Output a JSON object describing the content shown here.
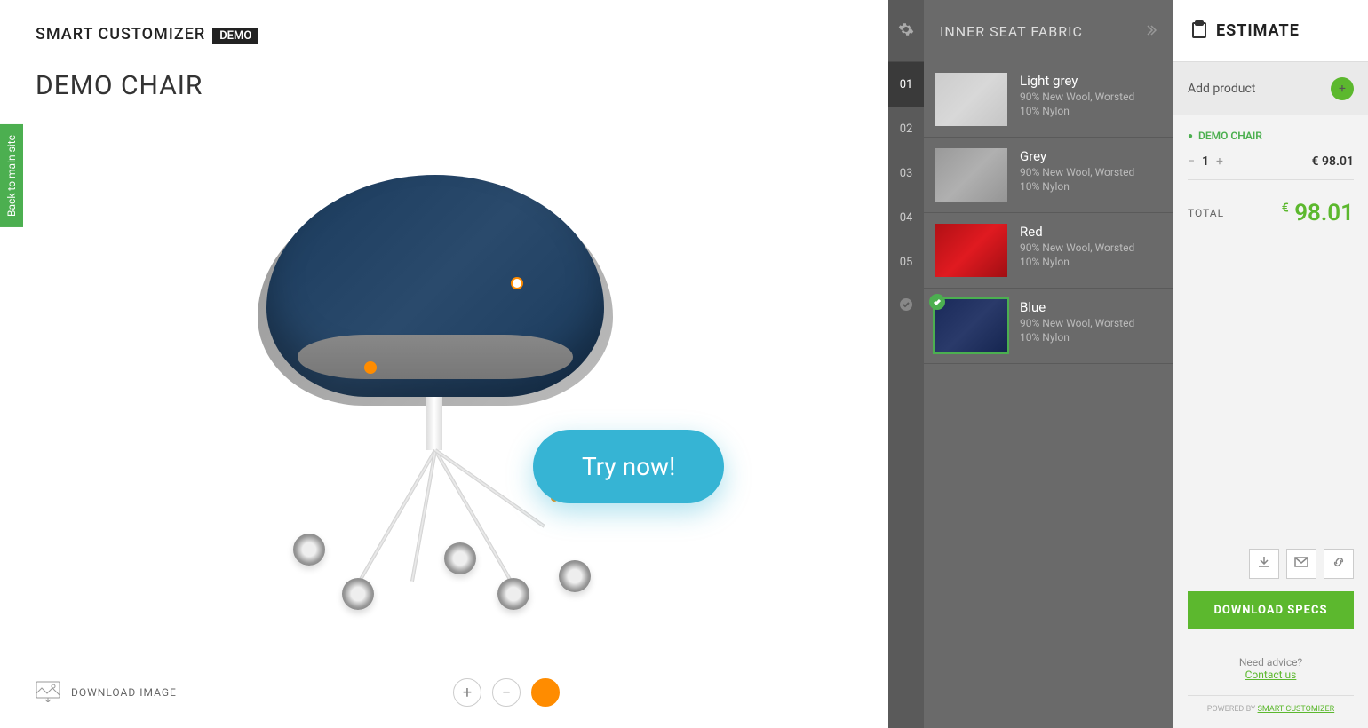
{
  "back_tab": "Back to main site",
  "logo": {
    "brand": "SMART CUSTOMIZER",
    "badge": "DEMO"
  },
  "product_title": "DEMO CHAIR",
  "try_now": "Try now!",
  "download_image": "DOWNLOAD IMAGE",
  "steps": {
    "items": [
      "01",
      "02",
      "03",
      "04",
      "05"
    ],
    "active_index": 0
  },
  "options": {
    "title": "INNER SEAT FABRIC",
    "list": [
      {
        "name": "Light grey",
        "desc1": "90% New Wool, Worsted",
        "desc2": "10% Nylon",
        "swatch": "lightgrey",
        "selected": false
      },
      {
        "name": "Grey",
        "desc1": "90% New Wool, Worsted",
        "desc2": "10% Nylon",
        "swatch": "grey",
        "selected": false
      },
      {
        "name": "Red",
        "desc1": "90% New Wool, Worsted",
        "desc2": "10% Nylon",
        "swatch": "red",
        "selected": false
      },
      {
        "name": "Blue",
        "desc1": "90% New Wool, Worsted",
        "desc2": "10% Nylon",
        "swatch": "blue",
        "selected": true
      }
    ]
  },
  "estimate": {
    "title": "ESTIMATE",
    "add_product": "Add product",
    "product_name": "DEMO CHAIR",
    "qty": "1",
    "line_price": "€ 98.01",
    "total_label": "TOTAL",
    "total_currency": "€",
    "total_value": "98.01",
    "download_specs": "DOWNLOAD SPECS",
    "advice_q": "Need advice?",
    "advice_link": "Contact us",
    "powered_prefix": "POWERED BY ",
    "powered_link": "SMART CUSTOMIZER"
  }
}
